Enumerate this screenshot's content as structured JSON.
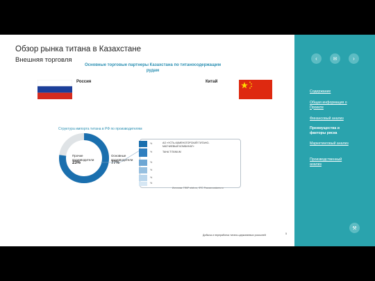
{
  "slide": {
    "title": "Обзор рынка титана в Казахстане",
    "subtitle": "Внешняя торговля",
    "partners_title": "Основные торговые партнеры Казахстана по титаносодержащим рудам",
    "countries": [
      "Россия",
      "Китай"
    ],
    "structure_title": "Структура импорта титана в РФ по производителям",
    "donut": {
      "others_label": "Прочие производители",
      "others_value": "23%",
      "main_label": "Основные производители",
      "main_value": "77%",
      "main_fraction": 0.77
    },
    "list_items": [
      {
        "label": "АО «УСТЬ-КАМЕНОГОРСКИЙ ТИТАНО-МАГНИЕВЫЙ КОМБИНАТ»",
        "pct": "%"
      },
      {
        "label": "TAHA TITANIUM",
        "pct": "%"
      },
      {
        "label": "",
        "pct": "%"
      },
      {
        "label": "",
        "pct": "%"
      },
      {
        "label": "",
        "pct": "%"
      },
      {
        "label": "",
        "pct": "%"
      }
    ],
    "source": "Источник: ГФКР whrb.ru, ФТС России customs.ru",
    "footer": "Добыча и переработка титано-циркониевых россыпей",
    "page_number": "5"
  },
  "sidebar": {
    "nav_buttons": [
      {
        "icon": "chevron-left-icon",
        "glyph": "‹"
      },
      {
        "icon": "envelope-icon",
        "glyph": "✉"
      },
      {
        "icon": "chevron-right-icon",
        "glyph": "›"
      }
    ],
    "links": [
      {
        "label": "Содержание",
        "active": false
      },
      {
        "label": "Общая информация о Проекте",
        "active": false
      },
      {
        "label": "Финансовый анализ",
        "active": false
      },
      {
        "label": "Преимущества и факторы риска",
        "active": true
      },
      {
        "label": "Маркетинговый анализ",
        "active": false
      },
      {
        "label": "Производственный анализ",
        "active": false
      }
    ],
    "bottom_icon": {
      "icon": "tools-icon",
      "glyph": "⚒"
    }
  },
  "colors": {
    "accent": "#2aa3ad",
    "blue": "#1a6fae",
    "donut_gray": "#dfe3e6"
  }
}
